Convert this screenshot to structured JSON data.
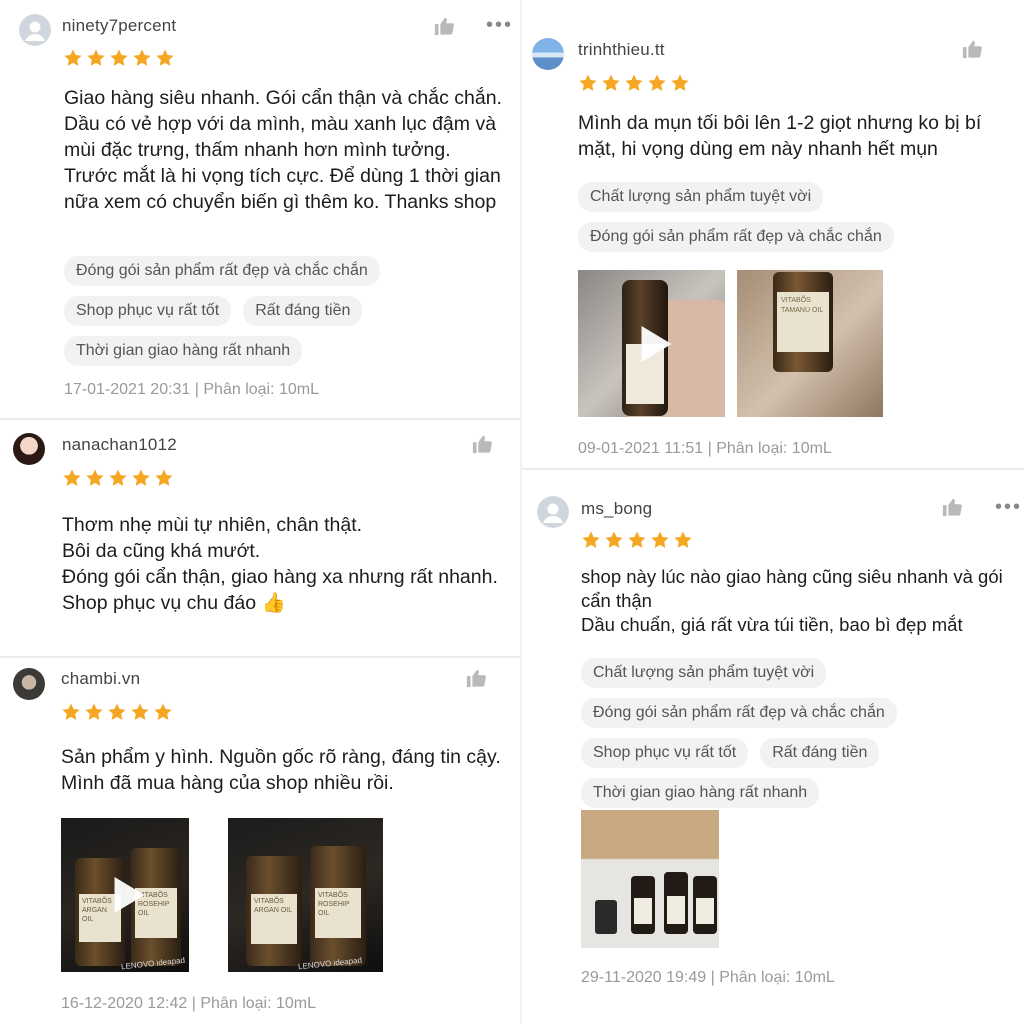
{
  "left": {
    "reviews": [
      {
        "username": "ninety7percent",
        "rating": 5,
        "text": "Giao hàng siêu nhanh. Gói cẩn thận và chắc chắn. Dầu có vẻ hợp với da mình, màu xanh lục đậm và mùi đặc trưng, thấm nhanh hơn mình tưởng. Trước mắt là hi vọng tích cực. Để dùng 1 thời gian nữa xem có chuyển biến gì thêm ko. Thanks shop",
        "tags": [
          "Đóng gói sản phẩm rất đẹp và chắc chắn",
          "Shop phục vụ rất tốt",
          "Rất đáng tiền",
          "Thời gian giao hàng rất nhanh"
        ],
        "meta": "17-01-2021 20:31 | Phân loại: 10mL"
      },
      {
        "username": "nanachan1012",
        "rating": 5,
        "text_lines": [
          "Thơm nhẹ mùi tự nhiên, chân thật.",
          "Bôi da cũng khá mướt.",
          "Đóng gói cẩn thận, giao hàng xa nhưng rất nhanh.",
          "Shop phục vụ chu đáo 👍"
        ]
      },
      {
        "username": "chambi.vn",
        "rating": 5,
        "text": "Sản phẩm y hình. Nguồn gốc rõ ràng, đáng tin cậy. Mình đã mua hàng của shop nhiều rồi.",
        "meta": "16-12-2020 12:42 | Phân loại: 10mL"
      }
    ]
  },
  "right": {
    "reviews": [
      {
        "username": "trinhthieu.tt",
        "rating": 5,
        "text": "Mình da mụn tối bôi lên 1-2 giọt nhưng ko bị bí mặt, hi vọng dùng em này nhanh hết mụn",
        "tags": [
          "Chất lượng sản phẩm tuyệt vời",
          "Đóng gói sản phẩm rất đẹp và chắc chắn"
        ],
        "meta": "09-01-2021 11:51 | Phân loại: 10mL"
      },
      {
        "username": "ms_bong",
        "rating": 5,
        "text_lines": [
          "shop này lúc nào giao hàng cũng siêu nhanh và gói cẩn thận",
          "Dầu chuẩn, giá rất vừa túi tiền, bao bì đẹp mắt"
        ],
        "tags": [
          "Chất lượng sản phẩm tuyệt vời",
          "Đóng gói sản phẩm rất đẹp và chắc chắn",
          "Shop phục vụ rất tốt",
          "Rất đáng tiền",
          "Thời gian giao hàng rất nhanh"
        ],
        "meta": "29-11-2020 19:49 | Phân loại: 10mL"
      }
    ]
  },
  "product_labels": {
    "brand": "VITABÕS",
    "oil1": "ARGAN OIL",
    "oil2": "ROSEHIP OIL",
    "oil3": "TAMANU OIL",
    "laptop": "LENOVO ideapad"
  },
  "colors": {
    "star": "#f5a623",
    "tag_bg": "#f2f2f2",
    "meta": "#9a9a9a"
  }
}
